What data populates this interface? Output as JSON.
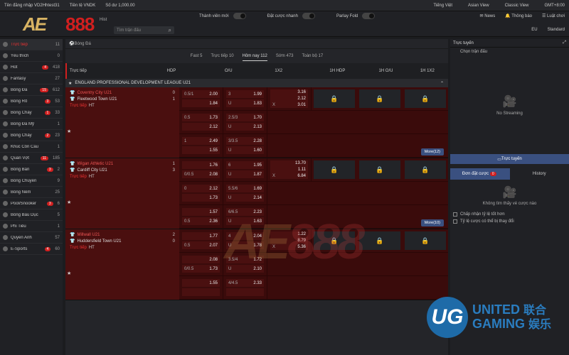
{
  "topbar": {
    "login": "Tên đăng nhập VD2Hhtest31",
    "currency": "Tiền tệ VNDK",
    "balance": "Số dư 1,000.00",
    "lang": "Tiếng Việt",
    "view1": "Asian View",
    "view2": "Classic View",
    "tz": "GMT+8:00"
  },
  "header": {
    "toggle1": "Thành viên mới",
    "toggle2": "Đặt cược nhanh",
    "toggle3": "Parlay Fold",
    "news": "News",
    "notify": "Thông báo",
    "rules": "Luật chơi",
    "region": "EU",
    "mode": "Standard",
    "search_placeholder": "Tìm trận đấu",
    "history_short": "Hist"
  },
  "logo": {
    "ae": "AE",
    "n": "888"
  },
  "sidebar": [
    {
      "label": "Trực tiếp",
      "count": "11",
      "badge": true
    },
    {
      "label": "Yêu thích",
      "count": "0"
    },
    {
      "label": "Hot",
      "count": "418",
      "badge": true,
      "b": "4"
    },
    {
      "label": "Fantasy",
      "count": "27"
    },
    {
      "label": "Bóng Đá",
      "count": "612",
      "badge": true,
      "b": "15"
    },
    {
      "label": "Bóng Rổ",
      "count": "53",
      "badge": true,
      "b": "3"
    },
    {
      "label": "Bóng Chày",
      "count": "33",
      "badge": true,
      "b": "1"
    },
    {
      "label": "Bóng Đá Mỹ",
      "count": "1"
    },
    {
      "label": "Bóng Chày",
      "count": "23",
      "badge": true,
      "b": "2"
    },
    {
      "label": "Khúc Côn Cầu",
      "count": "1"
    },
    {
      "label": "Quần Vợt",
      "count": "185",
      "badge": true,
      "b": "11"
    },
    {
      "label": "Bóng Bàn",
      "count": "2",
      "badge": true,
      "b": "3"
    },
    {
      "label": "Bóng Chuyền",
      "count": "9"
    },
    {
      "label": "Bóng Ném",
      "count": "25"
    },
    {
      "label": "Pool/Snooker",
      "count": "6",
      "badge": true,
      "b": "3"
    },
    {
      "label": "Bóng Bầu Dục",
      "count": "5"
    },
    {
      "label": "Phi Tiêu",
      "count": "1"
    },
    {
      "label": "Quyền Anh",
      "count": "57"
    },
    {
      "label": "E-Sports",
      "count": "60",
      "badge": true,
      "b": "4"
    }
  ],
  "main": {
    "crumb": "Bóng Đá",
    "tabs": [
      "Fast 5",
      "Trực tiếp 10",
      "Hôm nay 112",
      "Sớm 473",
      "Toàn bộ 17"
    ],
    "cols": [
      "Trực tiếp",
      "HDP",
      "O/U",
      "1X2",
      "1H HDP",
      "1H O/U",
      "1H 1X2"
    ],
    "league": "ENGLAND PROFESSIONAL DEVELOPMENT LEAGUE U21",
    "matches": [
      {
        "home": "Coventry City U21",
        "away": "Fleetwood Town U21",
        "hs": "0",
        "as": "1",
        "live": "Trực tiếp",
        "ht": "HT",
        "more": "More(12)",
        "rows": [
          [
            [
              "0.5/1",
              "2.00",
              "",
              "1.84"
            ],
            [
              "3",
              "1.99",
              "U",
              "1.83"
            ],
            [
              "",
              "3.16",
              "",
              "2.12",
              "X",
              "3.01"
            ]
          ],
          [
            [
              "0.5",
              "1.73",
              "",
              "2.12"
            ],
            [
              "2.5/3",
              "1.70",
              "U",
              "2.13"
            ]
          ],
          [
            [
              "1",
              "2.49",
              "",
              "1.55"
            ],
            [
              "3/3.5",
              "2.28",
              "U",
              "1.60"
            ]
          ]
        ]
      },
      {
        "home": "Wigan Athletic U21",
        "away": "Cardiff City U21",
        "hs": "1",
        "as": "3",
        "live": "Trực tiếp",
        "ht": "HT",
        "more": "More(10)",
        "rows": [
          [
            [
              "",
              "1.76",
              "0/0.5",
              "2.08"
            ],
            [
              "6",
              "1.95",
              "U",
              "1.87"
            ],
            [
              "",
              "13.70",
              "",
              "1.11",
              "X",
              "6.84"
            ]
          ],
          [
            [
              "0",
              "2.12",
              "",
              "1.73"
            ],
            [
              "5.5/6",
              "1.69",
              "U",
              "2.14"
            ]
          ],
          [
            [
              "",
              "1.57",
              "0.5",
              "2.36"
            ],
            [
              "6/6.5",
              "2.23",
              "U",
              "1.63"
            ]
          ]
        ]
      },
      {
        "home": "Millwall U21",
        "away": "Huddersfield Town U21",
        "hs": "2",
        "as": "0",
        "live": "Trực tiếp",
        "ht": "HT",
        "more": "",
        "rows": [
          [
            [
              "",
              "1.77",
              "0.5",
              "2.07"
            ],
            [
              "4",
              "2.04",
              "U",
              "1.78"
            ],
            [
              "",
              "1.22",
              "",
              "8.79",
              "X",
              "5.36"
            ]
          ],
          [
            [
              "",
              "2.08",
              "0/0.5",
              "1.73"
            ],
            [
              "3.5/4",
              "1.72",
              "U",
              "2.10"
            ]
          ],
          [
            [
              "",
              "1.55",
              "",
              ""
            ],
            [
              "4/4.5",
              "2.33",
              "",
              ""
            ]
          ]
        ]
      }
    ]
  },
  "right": {
    "title": "Trực tuyến",
    "select": "Chọn trận đấu",
    "nostream": "No Streaming",
    "btn": "Trực tuyến",
    "tab1": "Đơn đặt cược",
    "tab1_count": "0",
    "tab2": "History",
    "empty": "Không tìm thấy vé cược nào",
    "chk1": "Chấp nhận tỷ lệ tốt hơn",
    "chk2": "Tỷ lệ cược có thể bị thay đổi"
  },
  "brand": {
    "ug_mark": "UG",
    "ug1": "UNITED",
    "ug2": "GAMING",
    "cn1": "联合",
    "cn2": "娱乐"
  }
}
